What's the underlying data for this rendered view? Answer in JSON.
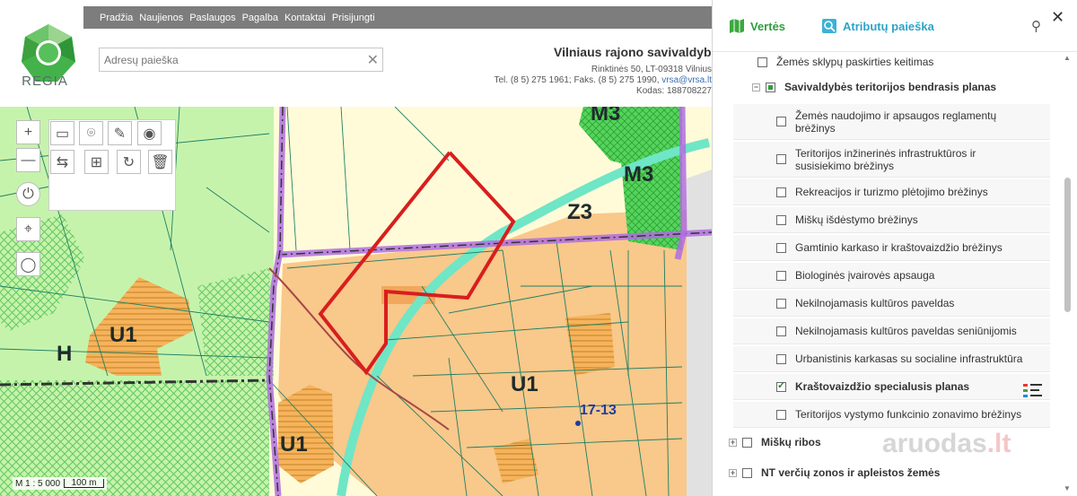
{
  "header": {
    "logo_text": "REGIA",
    "nav": [
      "Pradžia",
      "Naujienos",
      "Paslaugos",
      "Pagalba",
      "Kontaktai",
      "Prisijungti"
    ],
    "search_placeholder": "Adresų paieška",
    "municipality": "Vilniaus rajono savivaldybė",
    "address": "Rinktinės 50, LT-09318 Vilnius",
    "phone_prefix": "Tel. (8 5) 275 1961; Faks. (8 5) 275 1990, ",
    "email": "vrsa@vrsa.lt",
    "code": "Kodas: 188708227"
  },
  "map": {
    "labels": {
      "m3_top": "M3",
      "m3_right": "M3",
      "z3": "Z3",
      "u1_left": "U1",
      "u1_center": "U1",
      "u1_bottom": "U1",
      "h": "H",
      "parcel_no": "17-13"
    },
    "scale_text": "M 1 : 5 000",
    "scale_bar_text": "100 m",
    "colors": {
      "base": "#fffbd8",
      "residential": "#f9c88b",
      "forest": "#c4f0a8",
      "green_zone": "#4fd65a",
      "boundary": "#b06de0",
      "parcel_outline": "#d91e1e",
      "parcel_lines": "#1f7f63"
    }
  },
  "tools": {
    "zoom_in": "+",
    "zoom_out": "—",
    "delete": "🗑"
  },
  "panel": {
    "tab_layers": "Vertės",
    "tab_attr": "Atributų paieška",
    "close": "✕",
    "layers": [
      {
        "label": "Žemės sklypų paskirties keitimas",
        "state": "unchecked",
        "level": 1
      },
      {
        "label": "Savivaldybės teritorijos bendrasis planas",
        "state": "partial",
        "level": 1,
        "bold": true,
        "expander": "−"
      },
      {
        "label": "Žemės naudojimo ir apsaugos reglamentų brėžinys",
        "state": "unchecked",
        "level": 2
      },
      {
        "label": "Teritorijos inžinerinės infrastruktūros ir susisiekimo brėžinys",
        "state": "unchecked",
        "level": 2
      },
      {
        "label": "Rekreacijos ir turizmo plėtojimo brėžinys",
        "state": "unchecked",
        "level": 2
      },
      {
        "label": "Miškų išdėstymo brėžinys",
        "state": "unchecked",
        "level": 2
      },
      {
        "label": "Gamtinio karkaso ir kraštovaizdžio brėžinys",
        "state": "unchecked",
        "level": 2
      },
      {
        "label": "Biologinės įvairovės apsauga",
        "state": "unchecked",
        "level": 2
      },
      {
        "label": "Nekilnojamasis kultūros paveldas",
        "state": "unchecked",
        "level": 2
      },
      {
        "label": "Nekilnojamasis kultūros paveldas seniūnijomis",
        "state": "unchecked",
        "level": 2
      },
      {
        "label": "Urbanistinis karkasas su socialine infrastruktūra",
        "state": "unchecked",
        "level": 2
      },
      {
        "label": "Kraštovaizdžio specialusis planas",
        "state": "checked",
        "level": 2,
        "bold": true,
        "legend": true
      },
      {
        "label": "Teritorijos vystymo funkcinio zonavimo brėžinys",
        "state": "unchecked",
        "level": 2
      },
      {
        "label": "Miškų ribos",
        "state": "unchecked",
        "level": 0,
        "expander": "+"
      },
      {
        "label": "NT verčių zonos ir apleistos žemės",
        "state": "unchecked",
        "level": 0,
        "expander": "+"
      }
    ]
  },
  "watermark": {
    "text": "aruodas",
    "suffix": ".lt"
  }
}
